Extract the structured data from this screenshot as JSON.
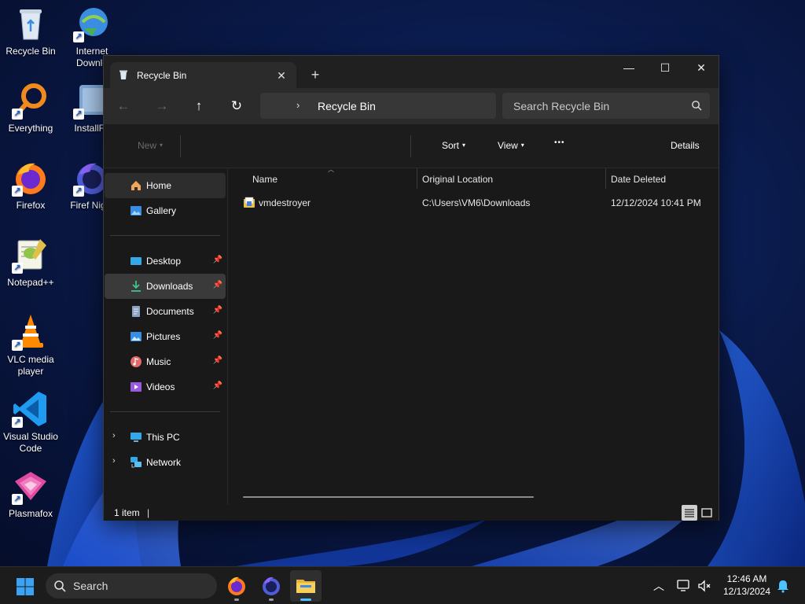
{
  "desktop": {
    "icons": [
      {
        "label": "Recycle Bin"
      },
      {
        "label": "Internet Downlo"
      },
      {
        "label": "Everything"
      },
      {
        "label": "InstallFo"
      },
      {
        "label": "Firefox"
      },
      {
        "label": "Firef Night"
      },
      {
        "label": "Notepad++"
      },
      {
        "label": "VLC media player"
      },
      {
        "label": "Visual Studio Code"
      },
      {
        "label": "Plasmafox"
      }
    ]
  },
  "window": {
    "tab_title": "Recycle Bin",
    "tab_close": "✕",
    "new_tab": "+",
    "minimize": "—",
    "maximize": "☐",
    "close": "✕"
  },
  "nav": {
    "back": "←",
    "forward": "→",
    "up": "↑",
    "refresh": "↻",
    "chevron": "›",
    "path": "Recycle Bin",
    "search_placeholder": "Search Recycle Bin"
  },
  "commandbar": {
    "new_label": "New",
    "sort_label": "Sort",
    "view_label": "View",
    "more_label": "•••",
    "details_label": "Details"
  },
  "sidebar": {
    "quick": [
      {
        "label": "Home"
      },
      {
        "label": "Gallery"
      }
    ],
    "pinned": [
      {
        "label": "Desktop"
      },
      {
        "label": "Downloads"
      },
      {
        "label": "Documents"
      },
      {
        "label": "Pictures"
      },
      {
        "label": "Music"
      },
      {
        "label": "Videos"
      }
    ],
    "devices": [
      {
        "label": "This PC"
      },
      {
        "label": "Network"
      }
    ]
  },
  "columns": {
    "name": "Name",
    "location": "Original Location",
    "deleted": "Date Deleted"
  },
  "files": [
    {
      "name": "vmdestroyer",
      "location": "C:\\Users\\VM6\\Downloads",
      "deleted": "12/12/2024 10:41 PM"
    }
  ],
  "status": {
    "count": "1 item",
    "caret": "|"
  },
  "taskbar": {
    "search_label": "Search",
    "time": "12:46 AM",
    "date": "12/13/2024"
  },
  "colors": {
    "accent": "#4cc2ff",
    "window_bg": "#191919",
    "navbar_bg": "#2b2b2b"
  }
}
